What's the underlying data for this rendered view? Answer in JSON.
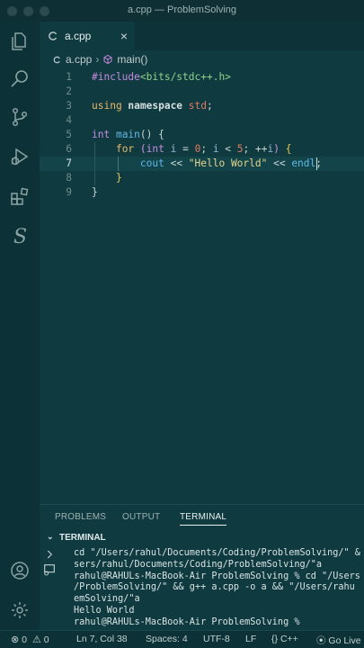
{
  "window": {
    "title": "a.cpp — ProblemSolving"
  },
  "activity_bar": {
    "items": [
      {
        "icon": "files-icon"
      },
      {
        "icon": "search-icon"
      },
      {
        "icon": "source-control-icon"
      },
      {
        "icon": "run-debug-icon"
      },
      {
        "icon": "extensions-icon"
      },
      {
        "icon": "s-extension-icon"
      },
      {
        "icon": "account-icon"
      },
      {
        "icon": "gear-icon"
      }
    ]
  },
  "tab": {
    "label": "a.cpp",
    "close": "×"
  },
  "breadcrumb": {
    "file": "a.cpp",
    "separator": "›",
    "symbol": "main()"
  },
  "editor": {
    "line_numbers": [
      "1",
      "2",
      "3",
      "4",
      "5",
      "6",
      "7",
      "8",
      "9"
    ],
    "cursor": {
      "line": 7,
      "col": 38
    },
    "lines": [
      [
        {
          "t": "#include",
          "c": "pp"
        },
        {
          "t": "<bits/stdc++.h>",
          "c": "inc"
        }
      ],
      [],
      [
        {
          "t": "using ",
          "c": "kw"
        },
        {
          "t": "namespace ",
          "c": "kw2"
        },
        {
          "t": "std",
          "c": "num"
        },
        {
          "t": ";",
          "c": "plain"
        }
      ],
      [],
      [
        {
          "t": "int ",
          "c": "ty"
        },
        {
          "t": "main",
          "c": "fn"
        },
        {
          "t": "() {",
          "c": "plain"
        }
      ],
      [
        {
          "t": "    ",
          "c": "plain"
        },
        {
          "t": "for ",
          "c": "kw"
        },
        {
          "t": "(",
          "c": "brk2"
        },
        {
          "t": "int ",
          "c": "ty"
        },
        {
          "t": "i",
          "c": "var"
        },
        {
          "t": " = ",
          "c": "plain"
        },
        {
          "t": "0",
          "c": "num"
        },
        {
          "t": "; ",
          "c": "plain"
        },
        {
          "t": "i",
          "c": "var"
        },
        {
          "t": " < ",
          "c": "plain"
        },
        {
          "t": "5",
          "c": "num"
        },
        {
          "t": "; ",
          "c": "plain"
        },
        {
          "t": "++",
          "c": "plain"
        },
        {
          "t": "i",
          "c": "var"
        },
        {
          "t": ")",
          "c": "brk2"
        },
        {
          "t": " {",
          "c": "brk"
        }
      ],
      [
        {
          "t": "        ",
          "c": "plain"
        },
        {
          "t": "cout",
          "c": "fn"
        },
        {
          "t": " << ",
          "c": "plain"
        },
        {
          "t": "\"Hello World\"",
          "c": "str"
        },
        {
          "t": " << ",
          "c": "plain"
        },
        {
          "t": "endl",
          "c": "fn"
        },
        {
          "t": ";",
          "c": "plain"
        }
      ],
      [
        {
          "t": "    ",
          "c": "plain"
        },
        {
          "t": "}",
          "c": "brk"
        }
      ],
      [
        {
          "t": "}",
          "c": "plain"
        }
      ]
    ]
  },
  "panel": {
    "tabs": [
      "PROBLEMS",
      "OUTPUT",
      "TERMINAL"
    ],
    "active_tab": "TERMINAL",
    "terminal_header": "TERMINAL",
    "terminal_lines": [
      {
        "dot": "",
        "text": "cd \"/Users/rahul/Documents/Coding/ProblemSolving/\" &"
      },
      {
        "dot": "",
        "text": "sers/rahul/Documents/Coding/ProblemSolving/\"a"
      },
      {
        "dot": "blue",
        "text": "rahul@RAHULs-MacBook-Air ProblemSolving % cd \"/Users"
      },
      {
        "dot": "",
        "text": "/ProblemSolving/\" && g++ a.cpp -o a && \"/Users/rahu"
      },
      {
        "dot": "",
        "text": "emSolving/\"a"
      },
      {
        "dot": "",
        "text": "Hello World"
      },
      {
        "dot": "hollow",
        "text": "rahul@RAHULs-MacBook-Air ProblemSolving % "
      }
    ]
  },
  "status_bar": {
    "errors": "0",
    "warnings": "0",
    "position": "Ln 7, Col 38",
    "spaces": "Spaces: 4",
    "encoding": "UTF-8",
    "eol": "LF",
    "language": "C++",
    "go_live": "Go Live"
  },
  "colors": {
    "background": "#0f3a40",
    "activity_bar": "#0c3136",
    "accent_dot": "#3f9bd8"
  }
}
